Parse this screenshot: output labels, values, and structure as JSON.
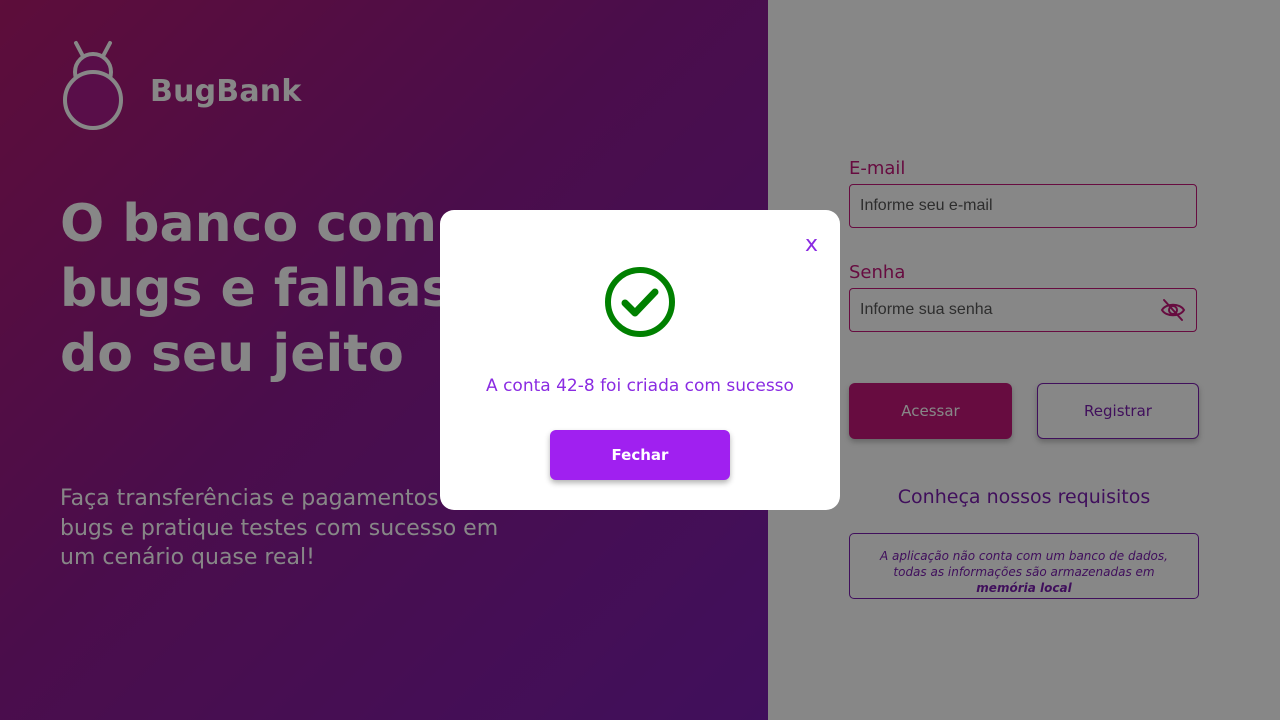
{
  "brand": {
    "name": "BugBank",
    "logo_icon": "bug-icon"
  },
  "hero": {
    "headline": "O banco com bugs e falhas do seu jeito",
    "subtext": "Faça transferências e pagamentos com bugs e pratique testes com sucesso em um cenário quase real!"
  },
  "login": {
    "email_label": "E-mail",
    "email_placeholder": "Informe seu e-mail",
    "password_label": "Senha",
    "password_placeholder": "Informe sua senha",
    "toggle_icon": "eye-slash-icon",
    "access_label": "Acessar",
    "register_label": "Registrar",
    "requirements_link": "Conheça nossos requisitos",
    "info_text": "A aplicação não conta com um banco de dados, todas as informações são armazenadas em",
    "info_bold": "memória local"
  },
  "modal": {
    "close_label": "x",
    "icon": "check-circle-icon",
    "message": "A conta 42-8 foi criada com sucesso",
    "button_label": "Fechar"
  },
  "colors": {
    "primary": "#c2177a",
    "secondary": "#7a1eae",
    "success": "#008000",
    "modal_accent": "#8a2be2"
  }
}
